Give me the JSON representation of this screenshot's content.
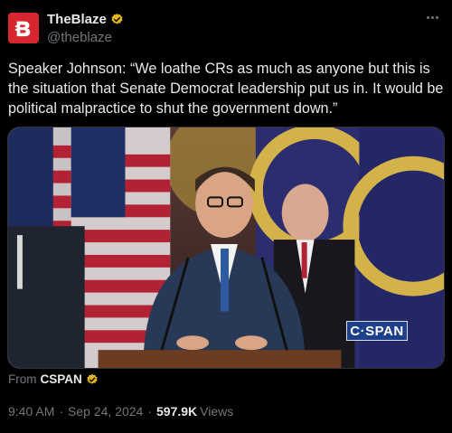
{
  "author": {
    "display_name": "TheBlaze",
    "handle": "@theblaze",
    "avatar_color": "#d7262e",
    "verified_badge_color": "#e2b719"
  },
  "tweet": {
    "text": "Speaker Johnson: “We loathe CRs as much as anyone but this is the situation that Senate Democrat leadership put us in. It would be political malpractice to shut the government down.”"
  },
  "media": {
    "watermark": "C·SPAN",
    "description_icon": "video-still"
  },
  "source": {
    "prefix": "From",
    "name": "CSPAN"
  },
  "meta": {
    "time": "9:40 AM",
    "separator1": "·",
    "date": "Sep 24, 2024",
    "separator2": "·",
    "views_count": "597.9K",
    "views_label": "Views"
  }
}
